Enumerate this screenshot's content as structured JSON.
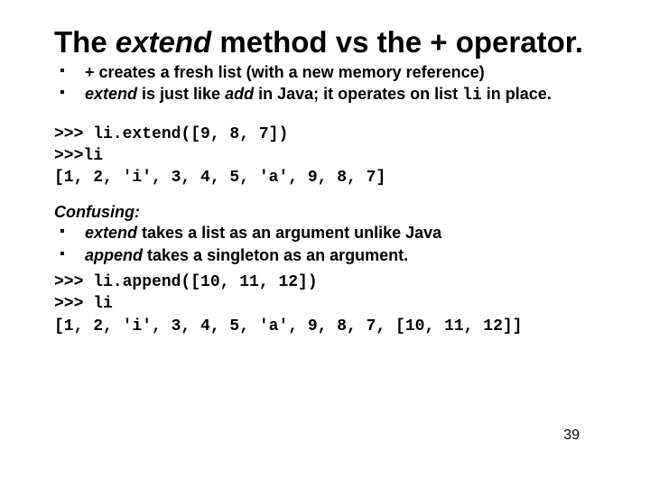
{
  "title": {
    "pre": "The ",
    "italic": "extend",
    "mid": " method vs the  ",
    "plus": "+",
    "post": " operator."
  },
  "bullets": [
    {
      "b1": "+",
      "t1": " creates a fresh list (with a new memory reference)"
    },
    {
      "bi1": "extend",
      "t1": " is just like ",
      "bi2": "add ",
      "t2": " in Java; it operates on list ",
      "mono": "li",
      "t3": " in place."
    }
  ],
  "code1": ">>> li.extend([9, 8, 7])\n>>>li\n[1, 2, 'i', 3, 4, 5, 'a', 9, 8, 7]",
  "confusing": {
    "lead": "Confusing:",
    "items": [
      {
        "i": "extend",
        "rest": " takes a list as an argument unlike Java"
      },
      {
        "i": "append",
        "rest": " takes a singleton as an argument."
      }
    ]
  },
  "code2": ">>> li.append([10, 11, 12])\n>>> li\n[1, 2, 'i', 3, 4, 5, 'a', 9, 8, 7, [10, 11, 12]]",
  "page": "39"
}
